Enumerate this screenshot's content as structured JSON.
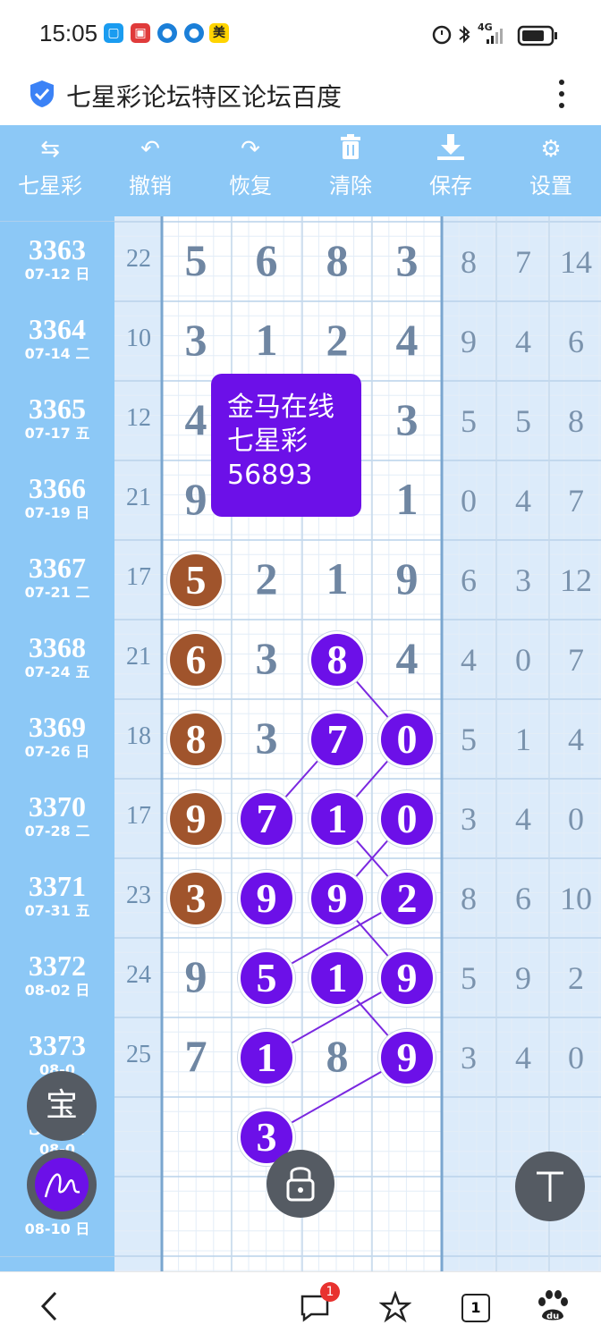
{
  "status_bar": {
    "time": "15:05",
    "app_icons": [
      "chat-app",
      "red-app",
      "blue-app",
      "blue-app",
      "meituan-app"
    ],
    "meituan_label": "美",
    "network_label": "4G"
  },
  "title_bar": {
    "title": "七星彩论坛特区论坛百度"
  },
  "toolbar": {
    "items": [
      {
        "label": "七星彩",
        "icon": "swap-arrows-icon"
      },
      {
        "label": "撤销",
        "icon": "undo-icon"
      },
      {
        "label": "恢复",
        "icon": "redo-icon"
      },
      {
        "label": "清除",
        "icon": "trash-icon"
      },
      {
        "label": "保存",
        "icon": "download-icon"
      },
      {
        "label": "设置",
        "icon": "gear-icon"
      }
    ]
  },
  "rows": [
    {
      "period": "3363",
      "date": "07-12 日",
      "sum": "22",
      "digits": [
        "5",
        "6",
        "8",
        "3"
      ],
      "extra": [
        "8",
        "7",
        "14"
      ]
    },
    {
      "period": "3364",
      "date": "07-14 二",
      "sum": "10",
      "digits": [
        "3",
        "1",
        "2",
        "4"
      ],
      "extra": [
        "9",
        "4",
        "6"
      ]
    },
    {
      "period": "3365",
      "date": "07-17 五",
      "sum": "12",
      "digits": [
        "4",
        "",
        "",
        "3"
      ],
      "extra": [
        "5",
        "5",
        "8"
      ]
    },
    {
      "period": "3366",
      "date": "07-19 日",
      "sum": "21",
      "digits": [
        "9",
        "",
        "",
        "1"
      ],
      "extra": [
        "0",
        "4",
        "7"
      ]
    },
    {
      "period": "3367",
      "date": "07-21 二",
      "sum": "17",
      "digits": [
        "5",
        "2",
        "1",
        "9"
      ],
      "extra": [
        "6",
        "3",
        "12"
      ]
    },
    {
      "period": "3368",
      "date": "07-24 五",
      "sum": "21",
      "digits": [
        "6",
        "3",
        "8",
        "4"
      ],
      "extra": [
        "4",
        "0",
        "7"
      ]
    },
    {
      "period": "3369",
      "date": "07-26 日",
      "sum": "18",
      "digits": [
        "8",
        "3",
        "7",
        "0"
      ],
      "extra": [
        "5",
        "1",
        "4"
      ]
    },
    {
      "period": "3370",
      "date": "07-28 二",
      "sum": "17",
      "digits": [
        "9",
        "7",
        "1",
        "0"
      ],
      "extra": [
        "3",
        "4",
        "0"
      ]
    },
    {
      "period": "3371",
      "date": "07-31 五",
      "sum": "23",
      "digits": [
        "3",
        "9",
        "9",
        "2"
      ],
      "extra": [
        "8",
        "6",
        "10"
      ]
    },
    {
      "period": "3372",
      "date": "08-02 日",
      "sum": "24",
      "digits": [
        "9",
        "5",
        "1",
        "9"
      ],
      "extra": [
        "5",
        "9",
        "2"
      ]
    },
    {
      "period": "3373",
      "date": "08-0",
      "sum": "25",
      "digits": [
        "7",
        "1",
        "8",
        "9"
      ],
      "extra": [
        "3",
        "4",
        "0"
      ]
    },
    {
      "period": "3374",
      "date": "08-0",
      "sum": "",
      "digits": [
        "",
        "3",
        "",
        ""
      ],
      "extra": [
        "",
        "",
        ""
      ]
    },
    {
      "period": "33",
      "date": "08-10 日",
      "sum": "",
      "digits": [
        "",
        "",
        "",
        ""
      ],
      "extra": [
        "",
        "",
        ""
      ]
    }
  ],
  "balls": {
    "brown": [
      [
        4,
        0
      ],
      [
        5,
        0
      ],
      [
        6,
        0
      ],
      [
        7,
        0
      ],
      [
        8,
        0
      ]
    ],
    "purple": [
      [
        5,
        2
      ],
      [
        6,
        2
      ],
      [
        6,
        3
      ],
      [
        7,
        1
      ],
      [
        7,
        2
      ],
      [
        7,
        3
      ],
      [
        8,
        1
      ],
      [
        8,
        2
      ],
      [
        8,
        3
      ],
      [
        9,
        1
      ],
      [
        9,
        2
      ],
      [
        9,
        3
      ],
      [
        10,
        1
      ],
      [
        10,
        3
      ],
      [
        11,
        1
      ]
    ]
  },
  "popup": {
    "line1": "金马在线",
    "line2": "七星彩",
    "line3": "56893"
  },
  "fabs": {
    "bao_label": "宝"
  },
  "bottom_nav": {
    "badge_count": "1",
    "tab_count": "1"
  },
  "colors": {
    "toolbar_bg": "#8cc8f6",
    "ball_purple": "#6c10e8",
    "ball_brown": "#a0542c",
    "digit_text": "#6f86a2"
  }
}
